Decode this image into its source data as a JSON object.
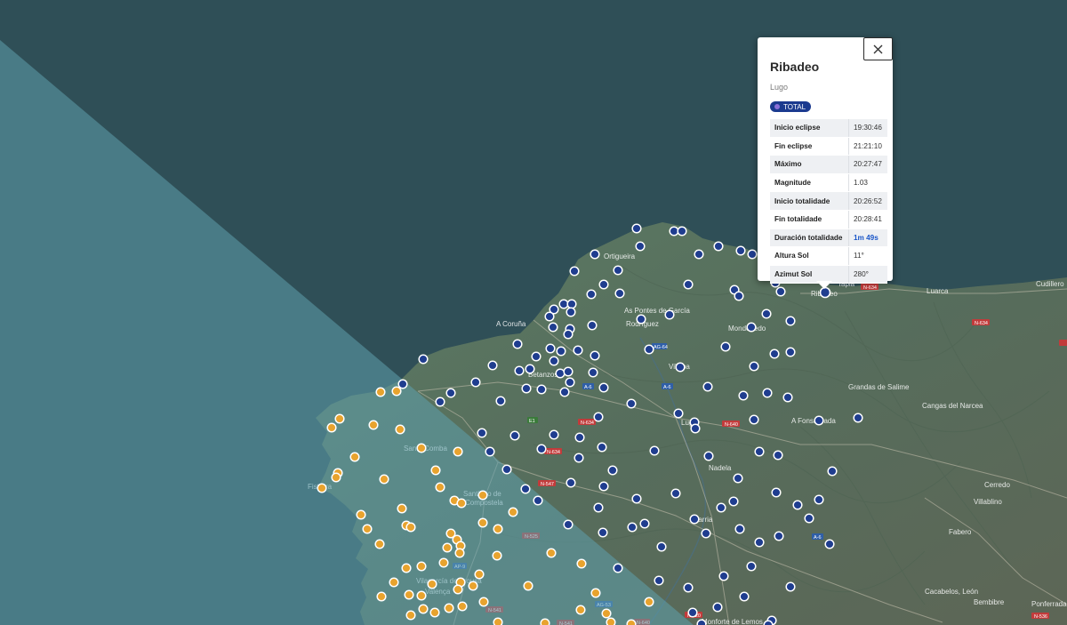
{
  "popup": {
    "title": "Ribadeo",
    "subtitle": "Lugo",
    "badge": "TOTAL",
    "rows": [
      {
        "label": "Inicio eclipse",
        "value": "19:30:46"
      },
      {
        "label": "Fin eclipse",
        "value": "21:21:10"
      },
      {
        "label": "Máximo",
        "value": "20:27:47"
      },
      {
        "label": "Magnitude",
        "value": "1.03"
      },
      {
        "label": "Inicio totalidade",
        "value": "20:26:52"
      },
      {
        "label": "Fin totalidade",
        "value": "20:28:41"
      },
      {
        "label": "Duración totalidade",
        "value": "1m 49s"
      },
      {
        "label": "Altura Sol",
        "value": "11°"
      },
      {
        "label": "Azimut Sol",
        "value": "280°"
      }
    ]
  },
  "map_labels": {
    "towns": [
      "A Coruña",
      "Santiago de Compostela",
      "Lugo",
      "Ribadeo",
      "Monforte de Lemos",
      "Ponferrada",
      "Bembibre",
      "Villablino",
      "Cacabelos, León",
      "Vilagarcía de Arousa",
      "Grandas de Salime",
      "Luarca",
      "Cudillero",
      "A Fonsagrada",
      "As Pontes de García Rodríguez",
      "Fisterra",
      "Santa Comba",
      "Tapia",
      "Nadela",
      "Fabero",
      "Vilalba",
      "Ortigueira",
      "Cangas del Narcea",
      "Cerredo",
      "Valença",
      "Mondoñedo",
      "Sarria",
      "Betanzos"
    ],
    "roads": [
      "N-634",
      "N-640",
      "A-6",
      "A-8",
      "AP-9",
      "N-525",
      "N-547",
      "AG-53",
      "N-541",
      "N-536",
      "N-120",
      "A-52",
      "A-76",
      "N-634",
      "A-54",
      "AG-64"
    ]
  },
  "colors": {
    "sea": "#2f4f57",
    "shadow": "#4c7f8a",
    "land": "#5a7261",
    "marker_total": "#1f3d8f",
    "marker_partial": "#e8a32e",
    "badge": "#1b3a8f"
  },
  "markers_total_count": 170,
  "markers_partial_count": 80
}
